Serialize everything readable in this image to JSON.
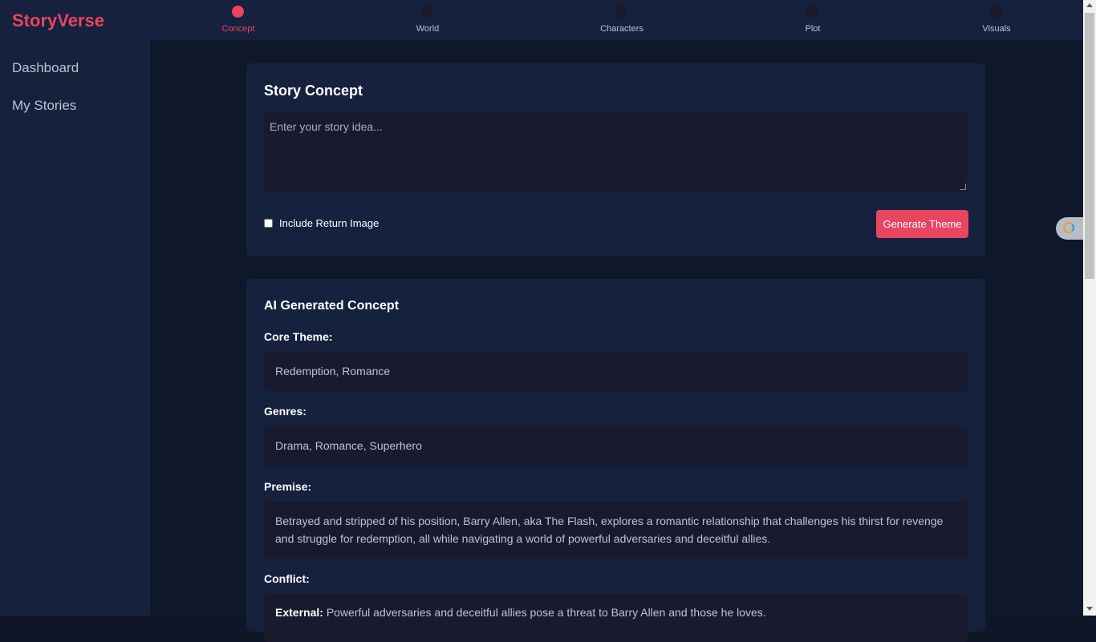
{
  "brand": "StoryVerse",
  "sidebar": {
    "items": [
      {
        "label": "Dashboard"
      },
      {
        "label": "My Stories"
      }
    ]
  },
  "steps": [
    {
      "label": "Concept",
      "active": true
    },
    {
      "label": "World",
      "active": false
    },
    {
      "label": "Characters",
      "active": false
    },
    {
      "label": "Plot",
      "active": false
    },
    {
      "label": "Visuals",
      "active": false
    }
  ],
  "concept_card": {
    "title": "Story Concept",
    "placeholder": "Enter your story idea...",
    "checkbox_label": "Include Return Image",
    "checkbox_checked": false,
    "button_label": "Generate Theme"
  },
  "ai_card": {
    "title": "AI Generated Concept",
    "core_theme_label": "Core Theme:",
    "core_theme_value": "Redemption, Romance",
    "genres_label": "Genres:",
    "genres_value": "Drama, Romance, Superhero",
    "premise_label": "Premise:",
    "premise_value": "Betrayed and stripped of his position, Barry Allen, aka The Flash, explores a romantic relationship that challenges his thirst for revenge and struggle for redemption, all while navigating a world of powerful adversaries and deceitful allies.",
    "conflict_label": "Conflict:",
    "conflict_external_label": "External:",
    "conflict_external_value": "Powerful adversaries and deceitful allies pose a threat to Barry Allen and those he loves."
  },
  "colors": {
    "accent": "#e94560",
    "panel": "#16213e",
    "field": "#1a1a2e",
    "background": "#0f172a"
  }
}
